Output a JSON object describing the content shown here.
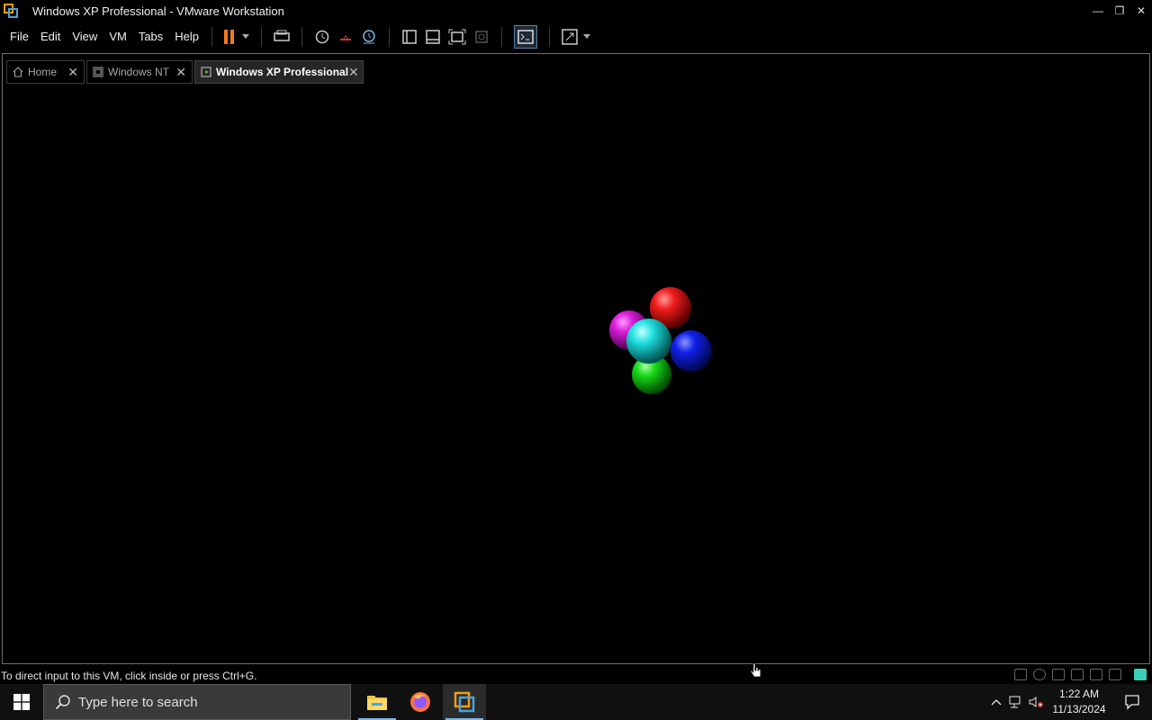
{
  "window": {
    "title": "Windows XP Professional - VMware Workstation",
    "minimize_glyph": "—",
    "restore_glyph": "❐",
    "close_glyph": "✕"
  },
  "menu": {
    "items": [
      {
        "label": "File",
        "name": "menu-file"
      },
      {
        "label": "Edit",
        "name": "menu-edit"
      },
      {
        "label": "View",
        "name": "menu-view"
      },
      {
        "label": "VM",
        "name": "menu-vm"
      },
      {
        "label": "Tabs",
        "name": "menu-tabs"
      },
      {
        "label": "Help",
        "name": "menu-help"
      }
    ]
  },
  "toolbar": {
    "icons": [
      "pause-icon",
      "send-ctrl-alt-del-icon",
      "snapshot-icon",
      "revert-snapshot-icon",
      "snapshot-manager-icon",
      "library-icon",
      "thumbnail-bar-icon",
      "full-screen-icon",
      "unity-icon",
      "console-view-icon",
      "stretch-guest-icon"
    ]
  },
  "tabs": [
    {
      "label": "Home",
      "icon": "home-icon",
      "active": false
    },
    {
      "label": "Windows NT",
      "icon": "vm-icon",
      "active": false
    },
    {
      "label": "Windows XP Professional",
      "icon": "vm-running-icon",
      "active": true
    }
  ],
  "vm_screen": {
    "content": "3d-spheres-screensaver",
    "sphere_colors": {
      "red": "#e81010",
      "magenta": "#d81cd8",
      "blue": "#1020e8",
      "green": "#18d818",
      "cyan": "#20e0e0"
    }
  },
  "statusbar": {
    "message": "To direct input to this VM, click inside or press Ctrl+G."
  },
  "taskbar": {
    "search_placeholder": "Type here to search",
    "apps": [
      "file-explorer-icon",
      "firefox-icon",
      "vmware-workstation-icon"
    ],
    "time": "1:22 AM",
    "date": "11/13/2024"
  },
  "colors": {
    "accent_pause": "#f07a27",
    "taskbar_underline": "#76b9ed"
  }
}
